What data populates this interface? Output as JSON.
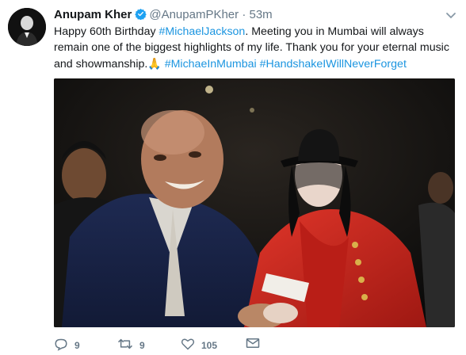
{
  "tweet": {
    "author": {
      "name": "Anupam Kher",
      "handle": "@AnupamPKher",
      "separator": "·",
      "time": "53m"
    },
    "text": {
      "part1": "Happy 60th Birthday ",
      "mention": "#MichaelJackson",
      "part2": ". Meeting you in Mumbai will always remain one of the biggest highlights of my life. Thank you for your eternal music and showmanship.",
      "emoji": "🙏",
      "hashtag1": "#MichaeInMumbai",
      "hashtag2": "#HandshakeIWillNeverForget"
    },
    "actions": {
      "replies": "9",
      "retweets": "9",
      "likes": "105"
    }
  },
  "colors": {
    "link": "#1b95e0",
    "meta": "#657786",
    "verified": "#1da1f2",
    "jacket": "#c8241c"
  },
  "icons": [
    "verified-badge-icon",
    "chevron-down-icon",
    "reply-icon",
    "retweet-icon",
    "like-icon",
    "message-icon"
  ]
}
